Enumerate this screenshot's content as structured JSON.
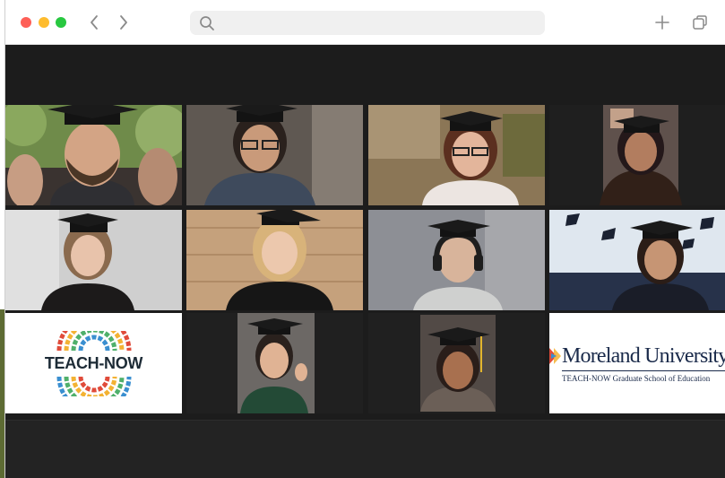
{
  "browser": {
    "address_value": "",
    "address_placeholder": "",
    "icons": [
      "close-dot",
      "minimize-dot",
      "zoom-dot",
      "back-icon",
      "forward-icon",
      "search-icon",
      "new-tab-icon",
      "tab-overview-icon"
    ],
    "colors": {
      "close": "#fe5f57",
      "minimize": "#febc2e",
      "zoom": "#28c840"
    }
  },
  "meeting": {
    "active_tile_color": "#4aa043",
    "tiles": [
      {
        "kind": "participant",
        "wearing": "graduation-cap"
      },
      {
        "kind": "participant",
        "wearing": "graduation-cap"
      },
      {
        "kind": "participant",
        "wearing": "graduation-cap"
      },
      {
        "kind": "participant",
        "wearing": "graduation-cap"
      },
      {
        "kind": "participant",
        "wearing": "graduation-cap"
      },
      {
        "kind": "participant",
        "wearing": "graduation-cap"
      },
      {
        "kind": "participant",
        "wearing": "graduation-cap"
      },
      {
        "kind": "participant",
        "wearing": "graduation-cap"
      },
      {
        "kind": "logo"
      },
      {
        "kind": "participant",
        "wearing": "graduation-cap"
      },
      {
        "kind": "participant",
        "wearing": "graduation-cap",
        "active": true
      },
      {
        "kind": "logo"
      }
    ],
    "logos": {
      "teach_now": "TEACH-NOW",
      "moreland_name": "Moreland University",
      "moreland_sub": "TEACH-NOW Graduate School of Education"
    }
  }
}
